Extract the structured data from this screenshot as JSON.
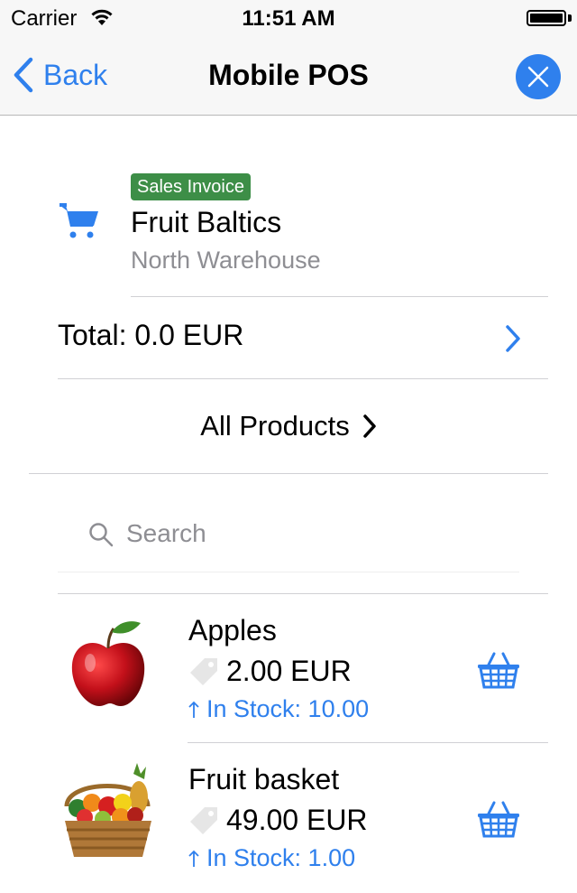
{
  "status_bar": {
    "carrier": "Carrier",
    "time": "11:51 AM"
  },
  "nav": {
    "back_label": "Back",
    "title": "Mobile POS"
  },
  "document": {
    "type_badge": "Sales Invoice",
    "customer": "Fruit Baltics",
    "warehouse": "North Warehouse",
    "total": "Total: 0.0 EUR"
  },
  "filter": {
    "label": "All Products"
  },
  "search": {
    "placeholder": "Search"
  },
  "products": [
    {
      "name": "Apples",
      "price": "2.00 EUR",
      "stock": "In Stock: 10.00"
    },
    {
      "name": "Fruit basket",
      "price": "49.00 EUR",
      "stock": "In Stock: 1.00"
    }
  ],
  "colors": {
    "accent": "#2f80ed",
    "badge": "#3d8e47",
    "secondary_text": "#8e8e93"
  }
}
